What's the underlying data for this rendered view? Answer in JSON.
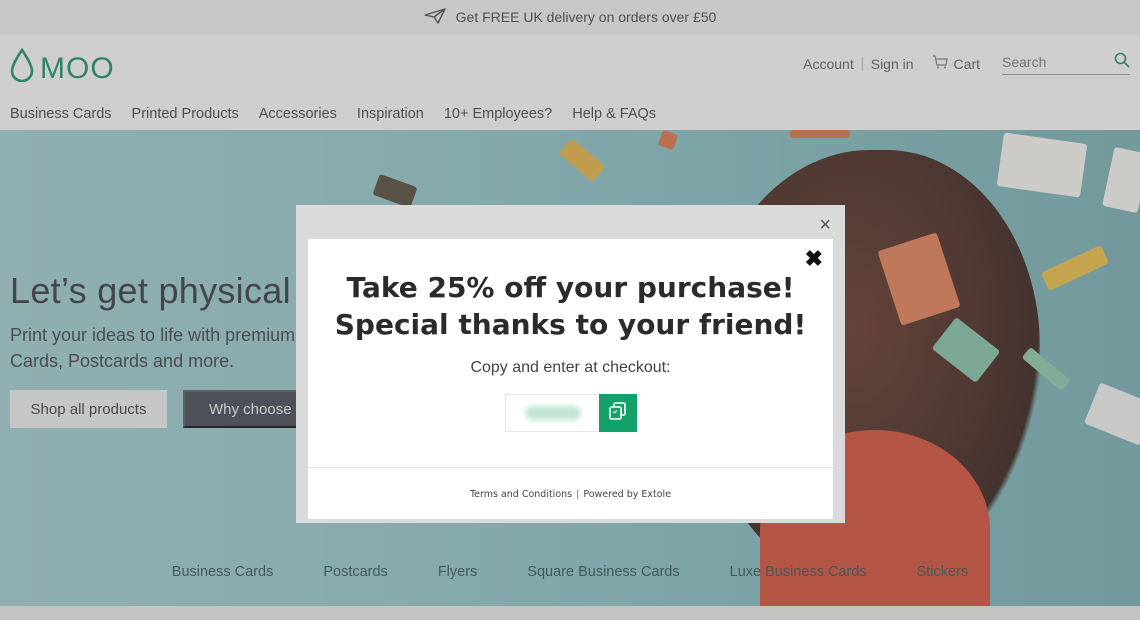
{
  "promo": {
    "text": "Get FREE UK delivery on orders over £50",
    "icon": "paper-plane-icon"
  },
  "header": {
    "logo": "MOO",
    "account": "Account",
    "signin": "Sign in",
    "cart": "Cart",
    "search_placeholder": "Search"
  },
  "nav": {
    "items": [
      "Business Cards",
      "Printed Products",
      "Accessories",
      "Inspiration",
      "10+ Employees?",
      "Help & FAQs"
    ]
  },
  "hero": {
    "title": "Let’s get physical",
    "subtitle": "Print your ideas to life with premium Cards, Postcards and more.",
    "shop_button": "Shop all products",
    "why_button": "Why choose M"
  },
  "categories": [
    "Business Cards",
    "Postcards",
    "Flyers",
    "Square Business Cards",
    "Luxe Business Cards",
    "Stickers"
  ],
  "modal": {
    "headline_line1": "Take 25% off your purchase!",
    "headline_line2": "Special thanks to your friend!",
    "copy_label": "Copy and enter at checkout:",
    "terms": "Terms and Conditions",
    "separator": "|",
    "powered": "Powered by Extole",
    "close_outer": "×",
    "close_inner": "✖"
  },
  "colors": {
    "brand_green": "#0d8a5e",
    "copy_button": "#12a06b",
    "dark_button": "#3a3f4b"
  }
}
